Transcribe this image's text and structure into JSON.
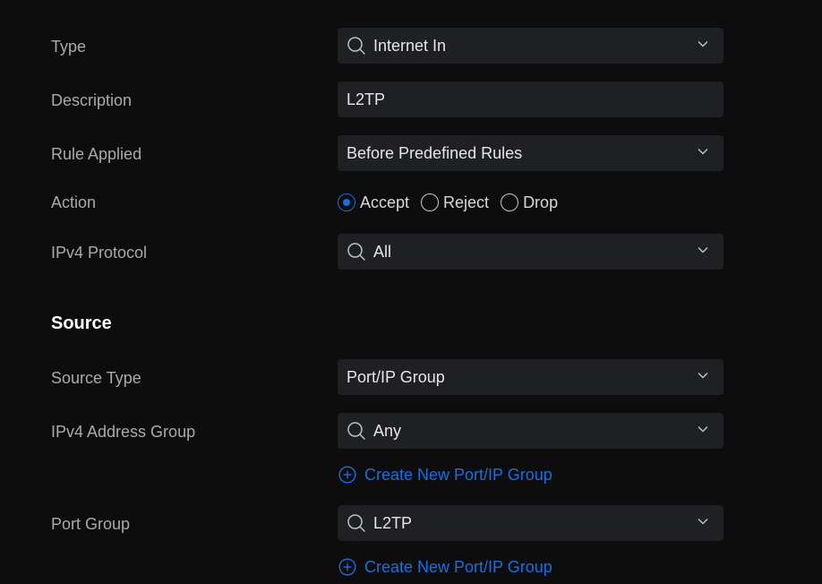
{
  "form": {
    "type": {
      "label": "Type",
      "value": "Internet In"
    },
    "description": {
      "label": "Description",
      "value": "L2TP"
    },
    "rule_applied": {
      "label": "Rule Applied",
      "value": "Before Predefined Rules"
    },
    "action": {
      "label": "Action",
      "options": [
        "Accept",
        "Reject",
        "Drop"
      ],
      "selected": "Accept"
    },
    "ipv4_protocol": {
      "label": "IPv4 Protocol",
      "value": "All"
    }
  },
  "source": {
    "title": "Source",
    "source_type": {
      "label": "Source Type",
      "value": "Port/IP Group"
    },
    "ipv4_address_group": {
      "label": "IPv4 Address Group",
      "value": "Any",
      "create_link": "Create New Port/IP Group"
    },
    "port_group": {
      "label": "Port Group",
      "value": "L2TP",
      "create_link": "Create New Port/IP Group"
    }
  },
  "icons": {
    "search": "search-icon",
    "chevron": "chevron-down-icon",
    "add": "plus-circle-icon"
  },
  "colors": {
    "background": "#0d0d0e",
    "field": "#1f2023",
    "accent": "#1a6fe0",
    "label": "#a9aaad"
  }
}
